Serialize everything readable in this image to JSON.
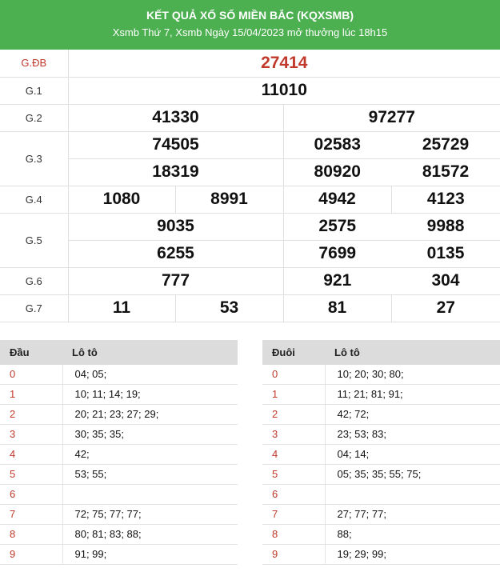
{
  "header": {
    "title": "KẾT QUẢ XỔ SỐ MIỀN BẮC (KQXSMB)",
    "subtitle": "Xsmb Thứ 7, Xsmb Ngày 15/04/2023 mở thưởng lúc 18h15"
  },
  "results": {
    "db": {
      "label": "G.ĐB",
      "numbers": [
        "27414"
      ]
    },
    "g1": {
      "label": "G.1",
      "numbers": [
        "11010"
      ]
    },
    "g2": {
      "label": "G.2",
      "numbers": [
        "41330",
        "97277"
      ]
    },
    "g3": {
      "label": "G.3",
      "numbers": [
        "74505",
        "02583",
        "25729",
        "18319",
        "80920",
        "81572"
      ]
    },
    "g4": {
      "label": "G.4",
      "numbers": [
        "1080",
        "8991",
        "4942",
        "4123"
      ]
    },
    "g5": {
      "label": "G.5",
      "numbers": [
        "9035",
        "2575",
        "9988",
        "6255",
        "7699",
        "0135"
      ]
    },
    "g6": {
      "label": "G.6",
      "numbers": [
        "777",
        "921",
        "304"
      ]
    },
    "g7": {
      "label": "G.7",
      "numbers": [
        "11",
        "53",
        "81",
        "27"
      ]
    }
  },
  "loto_dau": {
    "head_key": "Đầu",
    "head_val": "Lô tô",
    "rows": [
      {
        "k": "0",
        "v": "04; 05;"
      },
      {
        "k": "1",
        "v": "10; 11; 14; 19;"
      },
      {
        "k": "2",
        "v": "20; 21; 23; 27; 29;"
      },
      {
        "k": "3",
        "v": "30; 35; 35;"
      },
      {
        "k": "4",
        "v": "42;"
      },
      {
        "k": "5",
        "v": "53; 55;"
      },
      {
        "k": "6",
        "v": ""
      },
      {
        "k": "7",
        "v": "72; 75; 77; 77;"
      },
      {
        "k": "8",
        "v": "80; 81; 83; 88;"
      },
      {
        "k": "9",
        "v": "91; 99;"
      }
    ]
  },
  "loto_duoi": {
    "head_key": "Đuôi",
    "head_val": "Lô tô",
    "rows": [
      {
        "k": "0",
        "v": "10; 20; 30; 80;"
      },
      {
        "k": "1",
        "v": "11; 21; 81; 91;"
      },
      {
        "k": "2",
        "v": "42; 72;"
      },
      {
        "k": "3",
        "v": "23; 53; 83;"
      },
      {
        "k": "4",
        "v": "04; 14;"
      },
      {
        "k": "5",
        "v": "05; 35; 35; 55; 75;"
      },
      {
        "k": "6",
        "v": ""
      },
      {
        "k": "7",
        "v": "27; 77; 77;"
      },
      {
        "k": "8",
        "v": "88;"
      },
      {
        "k": "9",
        "v": "19; 29; 99;"
      }
    ]
  }
}
